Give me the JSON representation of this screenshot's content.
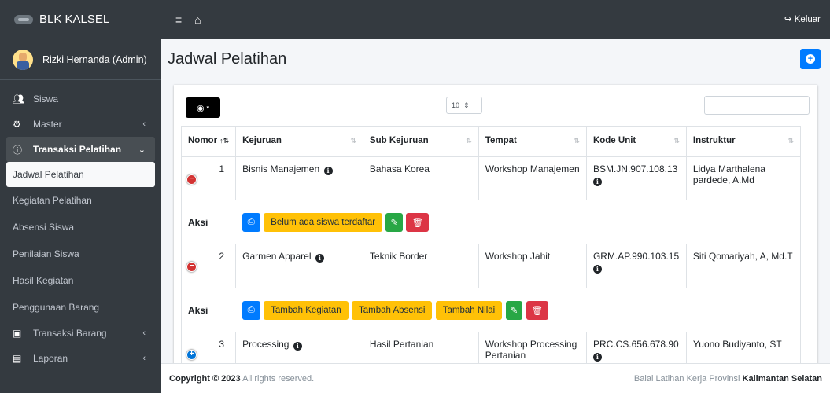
{
  "brand": {
    "name": "BLK KALSEL"
  },
  "user": {
    "name": "Rizki Hernanda (Admin)"
  },
  "sidebar": {
    "items": [
      {
        "label": "Siswa",
        "icon": "users-icon"
      },
      {
        "label": "Master",
        "icon": "cogs-icon"
      },
      {
        "label": "Transaksi Pelatihan",
        "icon": "info-icon"
      },
      {
        "label": "Jadwal Pelatihan"
      },
      {
        "label": "Kegiatan Pelatihan"
      },
      {
        "label": "Absensi Siswa"
      },
      {
        "label": "Penilaian Siswa"
      },
      {
        "label": "Hasil Kegiatan"
      },
      {
        "label": "Penggunaan Barang"
      },
      {
        "label": "Transaksi Barang",
        "icon": "box-icon"
      },
      {
        "label": "Laporan",
        "icon": "book-icon"
      }
    ]
  },
  "topbar": {
    "logout_label": "Keluar"
  },
  "page": {
    "title": "Jadwal Pelatihan"
  },
  "table": {
    "page_length": "10",
    "columns": [
      "Nomor",
      "Kejuruan",
      "Sub Kejuruan",
      "Tempat",
      "Kode Unit",
      "Instruktur"
    ],
    "rows": [
      {
        "no": "1",
        "kejuruan": "Bisnis Manajemen",
        "sub": "Bahasa Korea",
        "tempat": "Workshop Manajemen",
        "kode": "BSM.JN.907.108.13",
        "instruktur": "Lidya Marthalena pardede, A.Md",
        "aksi_label": "Aksi",
        "actions": [
          "Belum ada siswa terdaftar"
        ]
      },
      {
        "no": "2",
        "kejuruan": "Garmen Apparel",
        "sub": "Teknik Border",
        "tempat": "Workshop Jahit",
        "kode": "GRM.AP.990.103.15",
        "instruktur": "Siti Qomariyah, A, Md.T",
        "aksi_label": "Aksi",
        "actions": [
          "Tambah Kegiatan",
          "Tambah Absensi",
          "Tambah Nilai"
        ]
      },
      {
        "no": "3",
        "kejuruan": "Processing",
        "sub": "Hasil Pertanian",
        "tempat": "Workshop Processing Pertanian",
        "kode": "PRC.CS.656.678.90",
        "instruktur": "Yuono Budiyanto, ST"
      }
    ]
  },
  "footer": {
    "copyright_prefix": "Copyright © 2023",
    "copyright_suffix": "All rights reserved.",
    "org_prefix": "Balai Latihan Kerja Provinsi",
    "org_bold": "Kalimantan Selatan"
  },
  "colors": {
    "primary": "#007bff",
    "warning": "#ffc107",
    "success": "#28a745",
    "danger": "#dc3545",
    "sidebar": "#343a40"
  }
}
